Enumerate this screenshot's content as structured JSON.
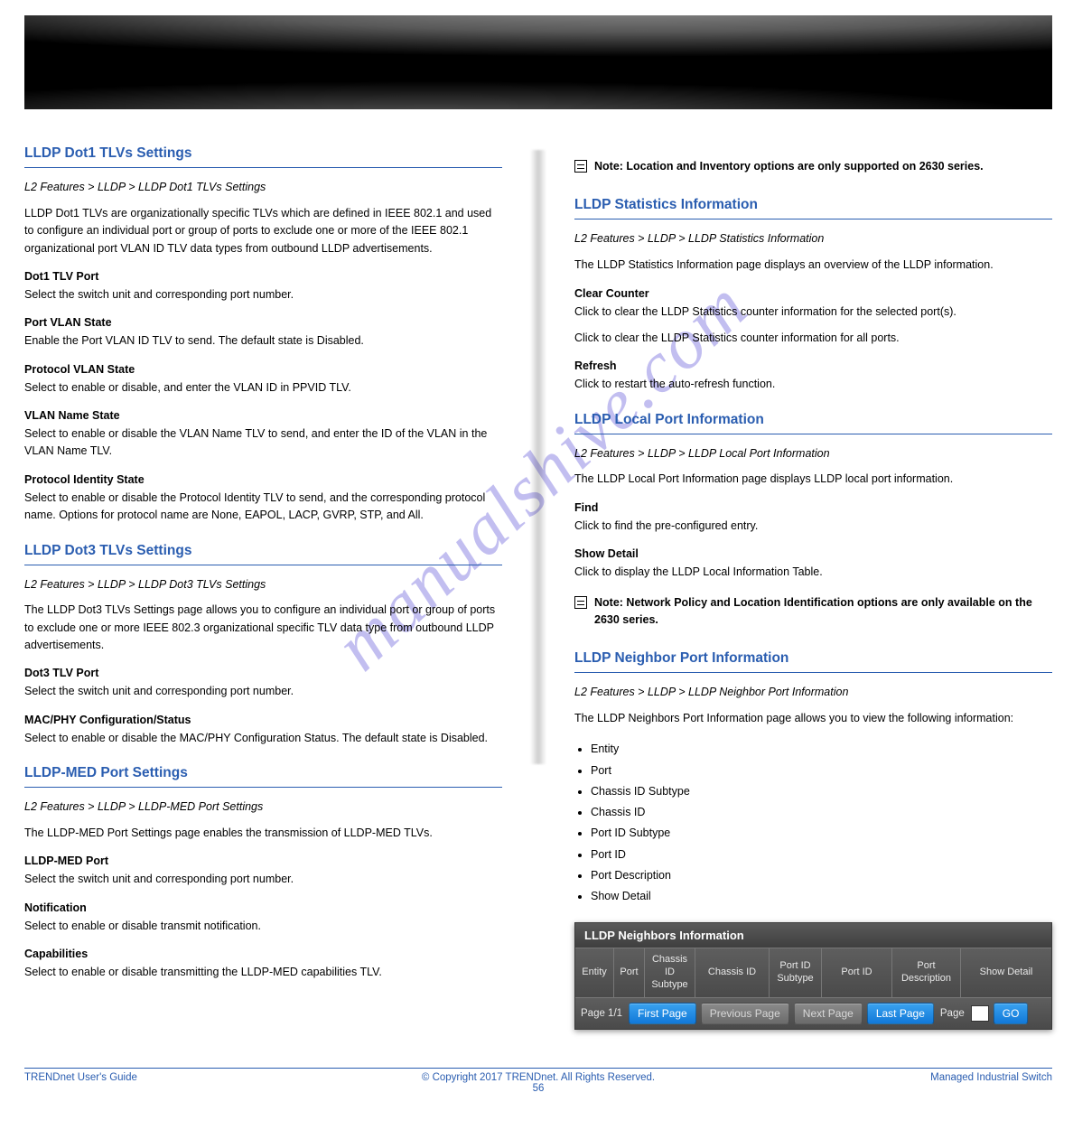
{
  "watermark": "manualshive.com",
  "left": {
    "section1": {
      "title": "LLDP Dot1 TLVs Settings"
    },
    "loc1": "L2 Features > LLDP > LLDP Dot1 TLVs Settings",
    "intro1": "LLDP Dot1 TLVs are organizationally specific TLVs which are defined in IEEE 802.1 and used to configure an individual port or group of ports to exclude one or more of the IEEE 802.1 organizational port VLAN ID TLV data types from outbound LLDP advertisements.",
    "h_dot1": "Dot1 TLV Port",
    "p_dot1": "Select the switch unit and corresponding port number.",
    "h_pvs": "Port VLAN State",
    "p_pvs": "Enable the Port VLAN ID TLV to send. The default state is Disabled.",
    "h_ppvs": "Protocol VLAN State",
    "p_ppvs": "Select to enable or disable, and enter the VLAN ID in PPVID TLV.",
    "h_vns": "VLAN Name State",
    "p_vns": "Select to enable or disable the VLAN Name TLV to send, and enter the ID of the VLAN in the VLAN Name TLV.",
    "h_pis": "Protocol Identity State",
    "p_pis": "Select to enable or disable the Protocol Identity TLV to send, and the corresponding protocol name. Options for protocol name are None, EAPOL, LACP, GVRP, STP, and All.",
    "section2": {
      "title": "LLDP Dot3 TLVs Settings"
    },
    "loc2": "L2 Features > LLDP > LLDP Dot3 TLVs Settings",
    "intro2": "The LLDP Dot3 TLVs Settings page allows you to configure an individual port or group of ports to exclude one or more IEEE 802.3 organizational specific TLV data type from outbound LLDP advertisements.",
    "h_dot3": "Dot3 TLV Port",
    "p_dot3": "Select the switch unit and corresponding port number.",
    "h_mps": "MAC/PHY Configuration/Status",
    "p_mps": "Select to enable or disable the MAC/PHY Configuration Status. The default state is Disabled.",
    "section3": {
      "title": "LLDP-MED Port Settings"
    },
    "loc3": "L2 Features > LLDP > LLDP-MED Port Settings",
    "intro3": "The LLDP-MED Port Settings page enables the transmission of LLDP-MED TLVs.",
    "h_mport": "LLDP-MED Port",
    "p_mport": "Select the switch unit and corresponding port number.",
    "h_not": "Notification",
    "p_not": "Select to enable or disable transmit notification.",
    "h_cap": "Capabilities",
    "p_cap": "Select to enable or disable transmitting the LLDP-MED capabilities TLV."
  },
  "right": {
    "noteA": "Note: Location and Inventory options are only supported on 2630 series.",
    "section4": {
      "title": "LLDP Statistics Information"
    },
    "loc4": "L2 Features > LLDP > LLDP Statistics Information",
    "intro4": "The LLDP Statistics Information page displays an overview of the LLDP information.",
    "h_clear": "Clear Counter",
    "p_clearA": "Click to clear the LLDP Statistics counter information for the selected port(s).",
    "p_clearB": "Click to clear the LLDP Statistics counter information for all ports.",
    "h_refresh": "Refresh",
    "p_refresh": "Click to restart the auto-refresh function.",
    "section5": {
      "title": "LLDP Local Port Information"
    },
    "loc5": "L2 Features > LLDP > LLDP Local Port Information",
    "intro5": "The LLDP Local Port Information page displays LLDP local port information.",
    "h_find": "Find",
    "p_find": "Click to find the pre-configured entry.",
    "h_sd": "Show Detail",
    "p_sd": "Click to display the LLDP Local Information Table.",
    "noteB": "Note: Network Policy and Location Identification options are only available on the 2630 series.",
    "section6": {
      "title": "LLDP Neighbor Port Information"
    },
    "loc6": "L2 Features > LLDP > LLDP Neighbor Port Information",
    "intro6": "The LLDP Neighbors Port Information page allows you to view the following information:",
    "bullets": [
      "Entity",
      "Port",
      "Chassis ID Subtype",
      "Chassis ID",
      "Port ID Subtype",
      "Port ID",
      "Port Description",
      "Show Detail"
    ]
  },
  "screenshot": {
    "title": "LLDP Neighbors Information",
    "cols": {
      "entity": "Entity",
      "port": "Port",
      "cis": "Chassis ID Subtype",
      "ci": "Chassis ID",
      "pis": "Port ID Subtype",
      "pi": "Port ID",
      "pd": "Port Description",
      "sd": "Show Detail"
    },
    "pager": {
      "status": "Page 1/1",
      "first": "First Page",
      "prev": "Previous Page",
      "next": "Next Page",
      "last": "Last Page",
      "pageLabel": "Page",
      "go": "GO"
    }
  },
  "footer": {
    "left": "TRENDnet User's Guide",
    "center": "© Copyright 2017 TRENDnet. All Rights Reserved.",
    "right": "Managed Industrial Switch",
    "pagenum": "56"
  }
}
